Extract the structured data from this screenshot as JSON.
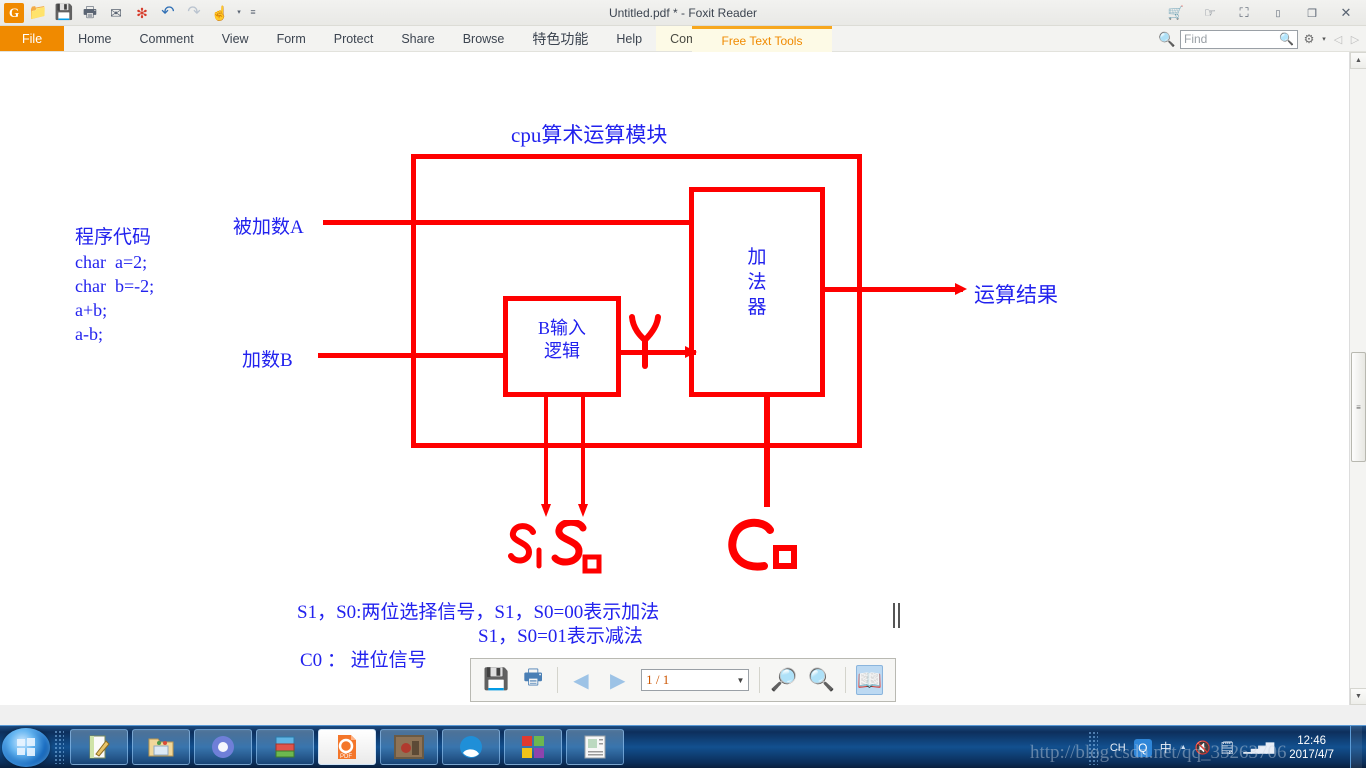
{
  "titlebar": {
    "title": "Untitled.pdf * - Foxit Reader",
    "quick_access": [
      {
        "name": "foxit-logo-icon",
        "glyph": "G"
      },
      {
        "name": "open-folder-icon",
        "glyph": "📂"
      },
      {
        "name": "save-icon",
        "glyph": "💾"
      },
      {
        "name": "print-icon",
        "glyph": "🖨"
      },
      {
        "name": "email-icon",
        "glyph": "✉"
      },
      {
        "name": "new-from-file-icon",
        "glyph": "✻"
      },
      {
        "name": "undo-icon",
        "glyph": "↶"
      },
      {
        "name": "redo-icon",
        "glyph": "↷"
      },
      {
        "name": "hand-tool-icon",
        "glyph": "☝"
      },
      {
        "name": "dropdown-caret",
        "glyph": "▾"
      },
      {
        "name": "customize-toolbar-icon",
        "glyph": "≡"
      }
    ],
    "window_buttons": [
      {
        "name": "cart-icon",
        "glyph": "🛒"
      },
      {
        "name": "hand-pointer-icon",
        "glyph": "☞"
      },
      {
        "name": "fullscreen-icon",
        "glyph": "⛶"
      },
      {
        "name": "minimize-icon",
        "glyph": "━"
      },
      {
        "name": "restore-icon",
        "glyph": "❐"
      },
      {
        "name": "close-icon",
        "glyph": "✕"
      }
    ]
  },
  "menubar": {
    "items": [
      {
        "label": "File",
        "kind": "file"
      },
      {
        "label": "Home",
        "kind": "normal"
      },
      {
        "label": "Comment",
        "kind": "normal"
      },
      {
        "label": "View",
        "kind": "normal"
      },
      {
        "label": "Form",
        "kind": "normal"
      },
      {
        "label": "Protect",
        "kind": "normal"
      },
      {
        "label": "Share",
        "kind": "normal"
      },
      {
        "label": "Browse",
        "kind": "normal"
      },
      {
        "label": "特色功能",
        "kind": "normal"
      },
      {
        "label": "Help",
        "kind": "normal"
      },
      {
        "label": "Comment Format",
        "kind": "context"
      }
    ],
    "contextual_tab": "Free Text Tools",
    "find": {
      "placeholder": "Find",
      "value": "",
      "search_icon": "search-icon",
      "settings_icon": "gear-icon",
      "prev_icon": "prev-result-icon",
      "next_icon": "next-result-icon"
    }
  },
  "document": {
    "title_text": "cpu算术运算模块",
    "code_block": [
      "程序代码",
      "char  a=2;",
      "char  b=-2;",
      "a+b;",
      "a-b;"
    ],
    "labels": {
      "input_a": "被加数A",
      "input_b": "加数B",
      "b_logic_line1": "B输入",
      "b_logic_line2": "逻辑",
      "adder_line1": "加",
      "adder_line2": "法",
      "adder_line3": "器",
      "result": "运算结果",
      "handwritten_s": "S₁S₀",
      "handwritten_c": "C₀"
    },
    "notes": [
      "S1，S0:两位选择信号，S1，S0=00表示加法",
      "S1，S0=01表示减法",
      "C0 ： 进位信号"
    ],
    "colors": {
      "diagram_line": "#fe0000",
      "text": "#2222ee"
    }
  },
  "pagetoolbar": {
    "save_icon": "save-icon",
    "print_icon": "print-icon",
    "prev_page_icon": "prev-page-icon",
    "next_page_icon": "next-page-icon",
    "page_value": "1 / 1",
    "zoom_out_icon": "zoom-out-icon",
    "zoom_in_icon": "zoom-in-icon",
    "read_mode_icon": "book-view-icon"
  },
  "scrollbars": {
    "v_up": "▲",
    "v_down": "▼",
    "h_left": "◀",
    "h_right": "▶",
    "grip": "≡"
  },
  "taskbar": {
    "start_label": "start-orb",
    "buttons": [
      {
        "name": "taskbar-notepad-icon"
      },
      {
        "name": "taskbar-explorer-icon"
      },
      {
        "name": "taskbar-chrome-icon"
      },
      {
        "name": "taskbar-winrar-icon"
      },
      {
        "name": "taskbar-foxit-pdf-icon",
        "label": "PDF"
      },
      {
        "name": "taskbar-photo-icon"
      },
      {
        "name": "taskbar-qq-browser-icon"
      },
      {
        "name": "taskbar-windows-icon"
      },
      {
        "name": "taskbar-document-icon"
      }
    ],
    "tray": [
      {
        "name": "tray-ime-icon",
        "label": "CH"
      },
      {
        "name": "tray-qq-icon",
        "label": "Q"
      },
      {
        "name": "tray-chinese-mode-icon",
        "label": "中"
      },
      {
        "name": "tray-expand-icon",
        "label": "▲"
      },
      {
        "name": "tray-volume-muted-icon",
        "label": "🔇"
      },
      {
        "name": "tray-action-center-icon",
        "label": "🗒"
      },
      {
        "name": "tray-network-icon",
        "label": "▮"
      }
    ],
    "clock_time": "12:46",
    "clock_date": "2017/4/7",
    "watermark": "http://blog.csdn.net/qq_35263706"
  }
}
